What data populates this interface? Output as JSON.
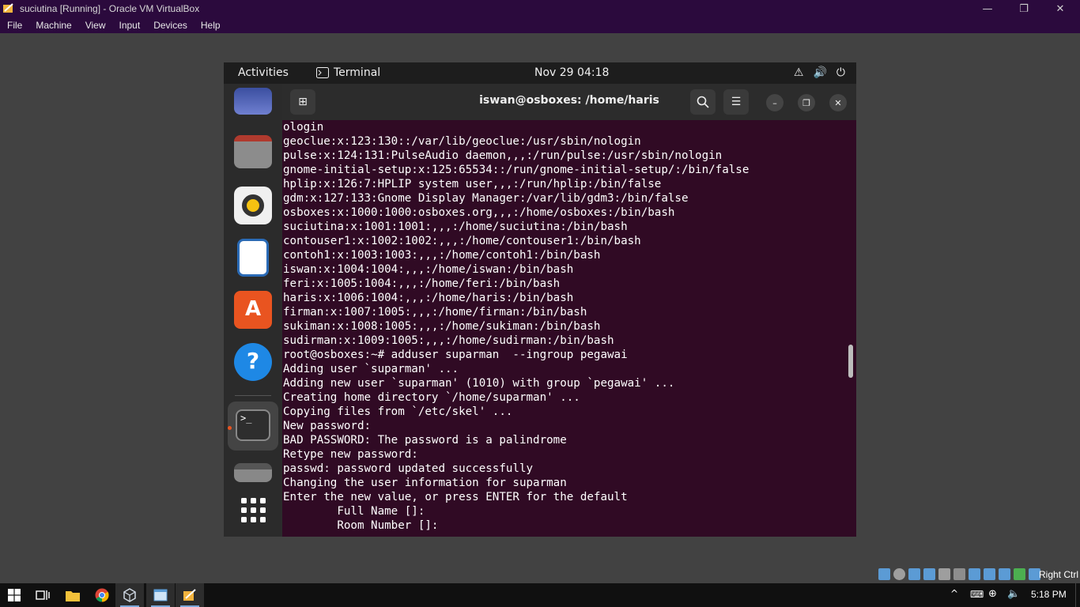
{
  "vbox": {
    "window_title": "suciutina [Running] - Oracle VM VirtualBox",
    "menu": [
      "File",
      "Machine",
      "View",
      "Input",
      "Devices",
      "Help"
    ],
    "host_key": "Right Ctrl"
  },
  "gnome": {
    "activities": "Activities",
    "app_name": "Terminal",
    "clock": "Nov 29  04:18"
  },
  "terminal": {
    "title": "iswan@osboxes: /home/haris",
    "lines": [
      "ologin",
      "geoclue:x:123:130::/var/lib/geoclue:/usr/sbin/nologin",
      "pulse:x:124:131:PulseAudio daemon,,,:/run/pulse:/usr/sbin/nologin",
      "gnome-initial-setup:x:125:65534::/run/gnome-initial-setup/:/bin/false",
      "hplip:x:126:7:HPLIP system user,,,:/run/hplip:/bin/false",
      "gdm:x:127:133:Gnome Display Manager:/var/lib/gdm3:/bin/false",
      "osboxes:x:1000:1000:osboxes.org,,,:/home/osboxes:/bin/bash",
      "suciutina:x:1001:1001:,,,:/home/suciutina:/bin/bash",
      "contouser1:x:1002:1002:,,,:/home/contouser1:/bin/bash",
      "contoh1:x:1003:1003:,,,:/home/contoh1:/bin/bash",
      "iswan:x:1004:1004:,,,:/home/iswan:/bin/bash",
      "feri:x:1005:1004:,,,:/home/feri:/bin/bash",
      "haris:x:1006:1004:,,,:/home/haris:/bin/bash",
      "firman:x:1007:1005:,,,:/home/firman:/bin/bash",
      "sukiman:x:1008:1005:,,,:/home/sukiman:/bin/bash",
      "sudirman:x:1009:1005:,,,:/home/sudirman:/bin/bash",
      "root@osboxes:~# adduser suparman  --ingroup pegawai",
      "Adding user `suparman' ...",
      "Adding new user `suparman' (1010) with group `pegawai' ...",
      "Creating home directory `/home/suparman' ...",
      "Copying files from `/etc/skel' ...",
      "New password:",
      "BAD PASSWORD: The password is a palindrome",
      "Retype new password:",
      "passwd: password updated successfully",
      "Changing the user information for suparman",
      "Enter the new value, or press ENTER for the default",
      "        Full Name []:",
      "        Room Number []:"
    ]
  },
  "taskbar": {
    "time": "5:18 PM"
  }
}
